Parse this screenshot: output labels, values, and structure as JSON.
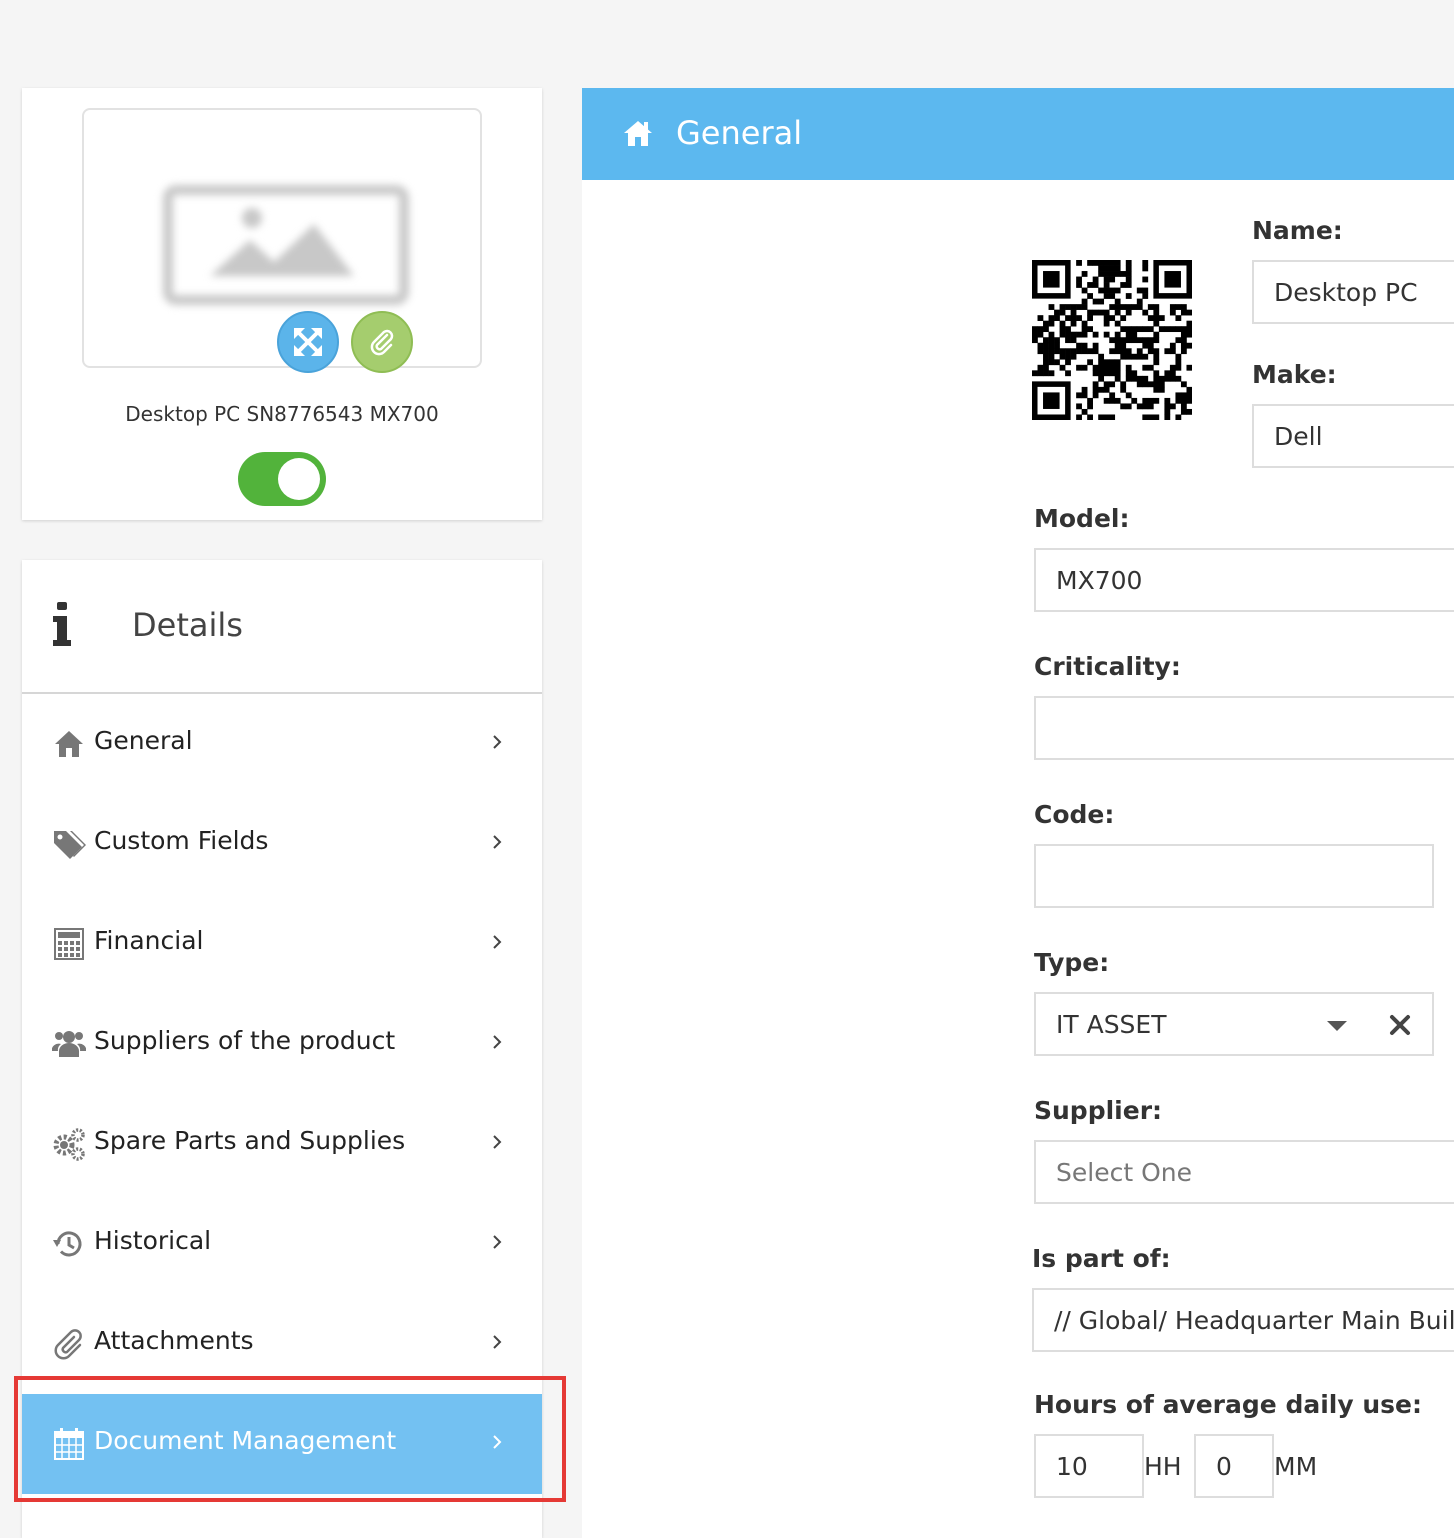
{
  "asset": {
    "title": "Desktop PC SN8776543 MX700",
    "active": true
  },
  "details": {
    "title": "Details",
    "nav": [
      {
        "label": "General",
        "icon": "home-icon"
      },
      {
        "label": "Custom Fields",
        "icon": "tags-icon"
      },
      {
        "label": "Financial",
        "icon": "calculator-icon"
      },
      {
        "label": "Suppliers of the product",
        "icon": "users-icon"
      },
      {
        "label": "Spare Parts and Supplies",
        "icon": "gears-icon"
      },
      {
        "label": "Historical",
        "icon": "history-icon"
      },
      {
        "label": "Attachments",
        "icon": "paperclip-icon"
      },
      {
        "label": "Document Management",
        "icon": "calendar-icon",
        "active": true
      }
    ]
  },
  "panel": {
    "title": "General",
    "fields": {
      "name": {
        "label": "Name:",
        "value": "Desktop PC"
      },
      "make": {
        "label": "Make:",
        "value": "Dell"
      },
      "model": {
        "label": "Model:",
        "value": "MX700"
      },
      "criticality": {
        "label": "Criticality:",
        "value": ""
      },
      "code": {
        "label": "Code:",
        "value": ""
      },
      "type": {
        "label": "Type:",
        "value": "IT ASSET"
      },
      "supplier": {
        "label": "Supplier:",
        "placeholder": "Select One"
      },
      "is_part_of": {
        "label": "Is part of:",
        "value": "// Global/ Headquarter Main Building"
      },
      "daily_use": {
        "label": "Hours of average daily use:",
        "hours": "10",
        "hours_unit": "HH",
        "minutes": "0",
        "minutes_unit": "MM"
      }
    }
  },
  "colors": {
    "header_blue": "#5cb8ef",
    "active_nav": "#73c1f2",
    "toggle_green": "#52b33b",
    "expand_blue": "#5bb4ea",
    "attach_green": "#a5cd6e",
    "highlight_red": "#e53935"
  }
}
